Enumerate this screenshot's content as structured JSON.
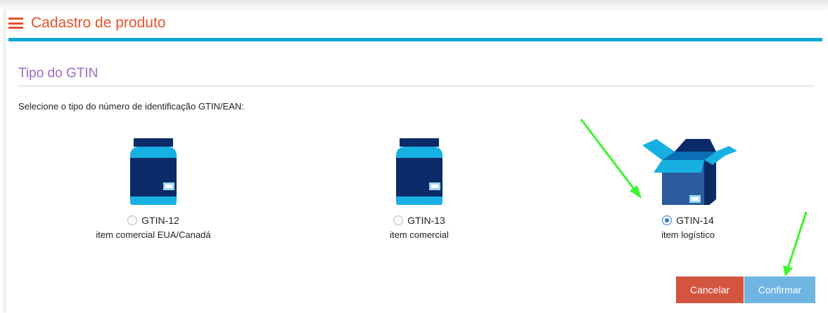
{
  "page": {
    "title": "Cadastro de produto"
  },
  "section": {
    "title": "Tipo do GTIN",
    "instructions": "Selecione o tipo do número de identificação GTIN/EAN:"
  },
  "options": [
    {
      "label": "GTIN-12",
      "description": "item comercial EUA/Canadá",
      "icon": "jar-icon",
      "selected": false
    },
    {
      "label": "GTIN-13",
      "description": "item comercial",
      "icon": "jar-icon",
      "selected": false
    },
    {
      "label": "GTIN-14",
      "description": "item logístico",
      "icon": "box-icon",
      "selected": true
    }
  ],
  "buttons": {
    "cancel": "Cancelar",
    "confirm": "Confirmar"
  },
  "colors": {
    "title": "#e2522c",
    "header_bar": "#09a7d8",
    "section_title": "#9b69c4",
    "cancel_button": "#d3553f",
    "confirm_button": "#6fb5e2",
    "annotation_arrow": "#3cf52a"
  }
}
